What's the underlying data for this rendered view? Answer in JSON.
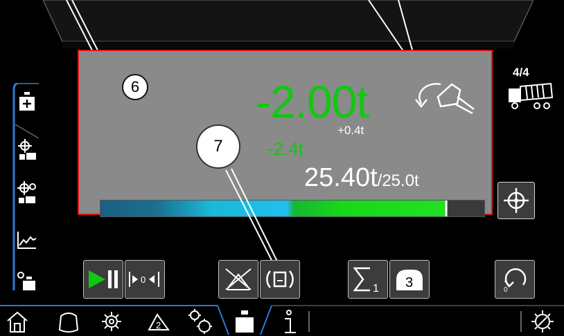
{
  "callouts": {
    "panel": "6",
    "button": "7"
  },
  "weight": {
    "current": "-2.00t",
    "delta": "+0.4t",
    "secondary": "-2.4t",
    "total": "25.40t",
    "target": "/25.0t"
  },
  "progress": {
    "fill_fraction": 0.9,
    "marker_fraction": 0.9
  },
  "truck_counter": "4/4",
  "toolbar": {
    "sum_subscript": "1",
    "bucket_number": "3"
  },
  "sidebar": {
    "items": [
      "tare-weigh-icon",
      "position-weigh-icon",
      "multi-position-icon",
      "trend-chart-icon",
      "zero-weigh-icon"
    ]
  },
  "bottom_nav": {
    "items": [
      "home-icon",
      "bucket-icon",
      "gear-icon",
      "mode-2-icon",
      "settings-gear-icon",
      "weigh-icon",
      "info-icon",
      "tools-icon"
    ]
  },
  "colors": {
    "green": "#10c810",
    "red_frame": "#e01818",
    "panel": "#8a8a8a",
    "accent_blue": "#2a7bd4"
  }
}
